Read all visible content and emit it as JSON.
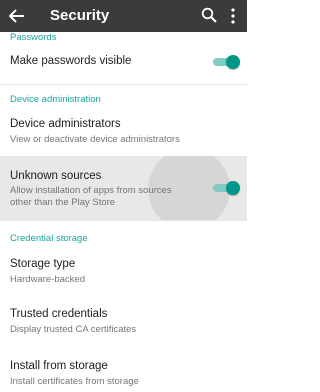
{
  "appbar": {
    "title": "Security",
    "back_icon": "arrow-back-icon",
    "search_icon": "search-icon",
    "more_icon": "more-vert-icon",
    "background": "#3b3b3b"
  },
  "accent_color": "#1ba39c",
  "sections": {
    "passwords": {
      "header": "Passwords",
      "make_passwords_visible": {
        "title": "Make passwords visible",
        "enabled": true
      }
    },
    "device_administration": {
      "header": "Device administration",
      "device_administrators": {
        "title": "Device administrators",
        "summary": "View or deactivate device administrators"
      },
      "unknown_sources": {
        "title": "Unknown sources",
        "summary": "Allow installation of apps from sources other than the Play Store",
        "enabled": true
      }
    },
    "credential_storage": {
      "header": "Credential storage",
      "storage_type": {
        "title": "Storage type",
        "summary": "Hardware-backed"
      },
      "trusted_credentials": {
        "title": "Trusted credentials",
        "summary": "Display trusted CA certificates"
      },
      "install_from_storage": {
        "title": "Install from storage",
        "summary": "Install certificates from storage"
      }
    }
  }
}
